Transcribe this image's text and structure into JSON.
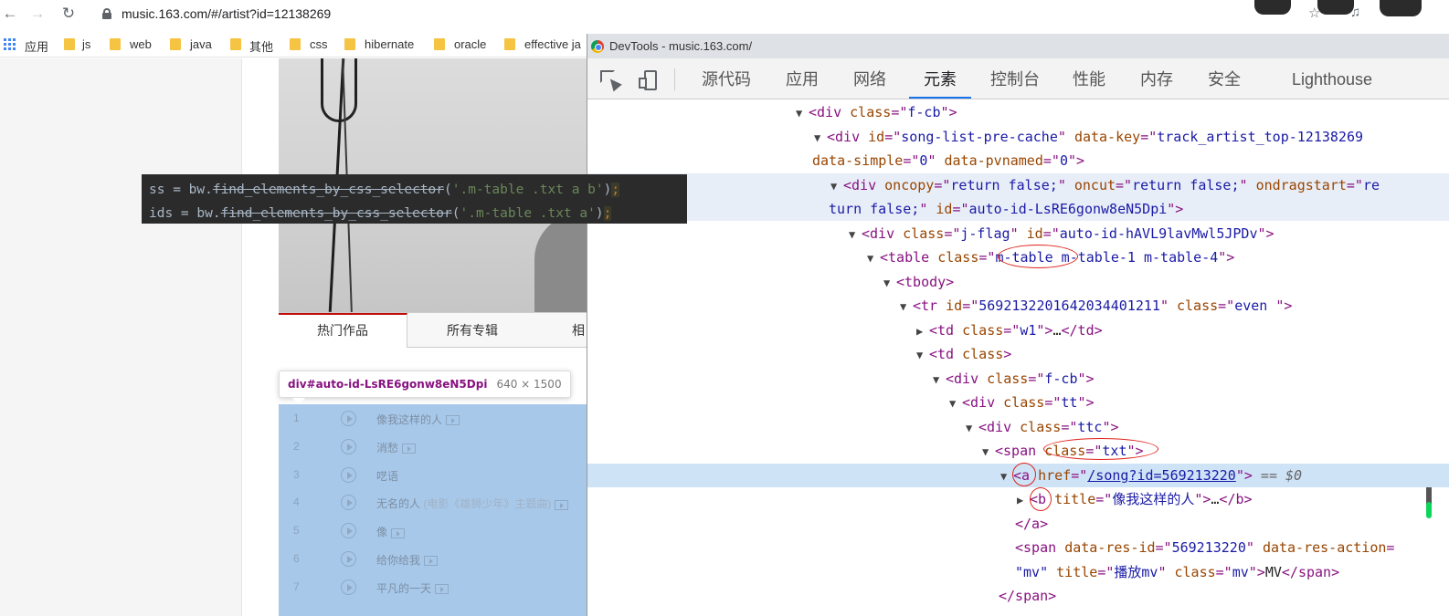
{
  "browser": {
    "url": "music.163.com/#/artist?id=12138269",
    "bookmarks": [
      "应用",
      "js",
      "web",
      "java",
      "其他",
      "css",
      "hibernate",
      "oracle",
      "effective ja"
    ]
  },
  "page": {
    "tabs": [
      "热门作品",
      "所有专辑",
      "相"
    ],
    "tooltip": {
      "selector": "div#auto-id-LsRE6gonw8eN5Dpi",
      "size": "640 × 1500"
    },
    "songs": [
      {
        "num": "1",
        "name": "像我这样的人",
        "sub": "",
        "mv": true
      },
      {
        "num": "2",
        "name": "消愁",
        "sub": "",
        "mv": true
      },
      {
        "num": "3",
        "name": "呓语",
        "sub": "",
        "mv": false
      },
      {
        "num": "4",
        "name": "无名的人",
        "sub": "(电影《雄狮少年》主题曲)",
        "mv": true
      },
      {
        "num": "5",
        "name": "像",
        "sub": "",
        "mv": true
      },
      {
        "num": "6",
        "name": "给你给我",
        "sub": "",
        "mv": true
      },
      {
        "num": "7",
        "name": "平凡的一天",
        "sub": "",
        "mv": true
      }
    ]
  },
  "code": {
    "line1": {
      "pre": "ss = bw.",
      "fn": "find_elements_by_css_selector",
      "open": "(",
      "arg": "'.m-table .txt a b'",
      "close": ")",
      "end": ";"
    },
    "line2": {
      "pre": "ids = bw.",
      "fn": "find_elements_by_css_selector",
      "open": "(",
      "arg": "'.m-table .txt a'",
      "close": ")",
      "end": ";"
    }
  },
  "devtools": {
    "title": "DevTools - music.163.com/",
    "tabs": [
      "源代码",
      "应用",
      "网络",
      "元素",
      "控制台",
      "性能",
      "内存",
      "安全",
      "Lighthouse"
    ],
    "active_tab": "元素",
    "ellipsis": "•••",
    "dom": [
      {
        "tri": "▼",
        "parts": [
          [
            "tag",
            "<div "
          ],
          [
            "attr",
            "class"
          ],
          [
            "tag",
            "=\""
          ],
          [
            "val",
            "f-cb"
          ],
          [
            "tag",
            "\">"
          ]
        ]
      },
      {
        "tri": "▼",
        "parts": [
          [
            "tag",
            "<div "
          ],
          [
            "attr",
            "id"
          ],
          [
            "tag",
            "=\""
          ],
          [
            "val",
            "song-list-pre-cache"
          ],
          [
            "tag",
            "\" "
          ],
          [
            "attr",
            "data-key"
          ],
          [
            "tag",
            "=\""
          ],
          [
            "val",
            "track_artist_top-12138269"
          ]
        ]
      },
      {
        "tri": "",
        "parts": [
          [
            "attr",
            "data-simple"
          ],
          [
            "tag",
            "=\""
          ],
          [
            "val",
            "0"
          ],
          [
            "tag",
            "\" "
          ],
          [
            "attr",
            "data-pvnamed"
          ],
          [
            "tag",
            "=\""
          ],
          [
            "val",
            "0"
          ],
          [
            "tag",
            "\">"
          ]
        ]
      },
      {
        "tri": "▼",
        "parts": [
          [
            "tag",
            "<div "
          ],
          [
            "attr",
            "oncopy"
          ],
          [
            "tag",
            "=\""
          ],
          [
            "val",
            "return false;"
          ],
          [
            "tag",
            "\" "
          ],
          [
            "attr",
            "oncut"
          ],
          [
            "tag",
            "=\""
          ],
          [
            "val",
            "return false;"
          ],
          [
            "tag",
            "\" "
          ],
          [
            "attr",
            "ondragstart"
          ],
          [
            "tag",
            "=\""
          ],
          [
            "val",
            "re"
          ]
        ]
      },
      {
        "tri": "",
        "parts": [
          [
            "val",
            "turn false;"
          ],
          [
            "tag",
            "\" "
          ],
          [
            "attr",
            "id"
          ],
          [
            "tag",
            "=\""
          ],
          [
            "val",
            "auto-id-LsRE6gonw8eN5Dpi"
          ],
          [
            "tag",
            "\">"
          ]
        ]
      },
      {
        "tri": "▼",
        "parts": [
          [
            "tag",
            "<div "
          ],
          [
            "attr",
            "class"
          ],
          [
            "tag",
            "=\""
          ],
          [
            "val",
            "j-flag"
          ],
          [
            "tag",
            "\" "
          ],
          [
            "attr",
            "id"
          ],
          [
            "tag",
            "=\""
          ],
          [
            "val",
            "auto-id-hAVL9lavMwl5JPDv"
          ],
          [
            "tag",
            "\">"
          ]
        ]
      },
      {
        "tri": "▼",
        "parts": [
          [
            "tag",
            "<table "
          ],
          [
            "attr",
            "class"
          ],
          [
            "tag",
            "=\""
          ],
          [
            "val",
            "m-table m-table-1 m-table-4"
          ],
          [
            "tag",
            "\">"
          ]
        ]
      },
      {
        "tri": "▼",
        "parts": [
          [
            "tag",
            "<tbody>"
          ]
        ]
      },
      {
        "tri": "▼",
        "parts": [
          [
            "tag",
            "<tr "
          ],
          [
            "attr",
            "id"
          ],
          [
            "tag",
            "=\""
          ],
          [
            "val",
            "5692132201642034401211"
          ],
          [
            "tag",
            "\" "
          ],
          [
            "attr",
            "class"
          ],
          [
            "tag",
            "=\""
          ],
          [
            "val",
            "even "
          ],
          [
            "tag",
            "\">"
          ]
        ]
      },
      {
        "tri": "▶",
        "parts": [
          [
            "tag",
            "<td "
          ],
          [
            "attr",
            "class"
          ],
          [
            "tag",
            "=\""
          ],
          [
            "val",
            "w1"
          ],
          [
            "tag",
            "\">"
          ],
          [
            "txt",
            "…"
          ],
          [
            "tag",
            "</td>"
          ]
        ]
      },
      {
        "tri": "▼",
        "parts": [
          [
            "tag",
            "<td "
          ],
          [
            "attr",
            "class"
          ],
          [
            "tag",
            ">"
          ]
        ]
      },
      {
        "tri": "▼",
        "parts": [
          [
            "tag",
            "<div "
          ],
          [
            "attr",
            "class"
          ],
          [
            "tag",
            "=\""
          ],
          [
            "val",
            "f-cb"
          ],
          [
            "tag",
            "\">"
          ]
        ]
      },
      {
        "tri": "▼",
        "parts": [
          [
            "tag",
            "<div "
          ],
          [
            "attr",
            "class"
          ],
          [
            "tag",
            "=\""
          ],
          [
            "val",
            "tt"
          ],
          [
            "tag",
            "\">"
          ]
        ]
      },
      {
        "tri": "▼",
        "parts": [
          [
            "tag",
            "<div "
          ],
          [
            "attr",
            "class"
          ],
          [
            "tag",
            "=\""
          ],
          [
            "val",
            "ttc"
          ],
          [
            "tag",
            "\">"
          ]
        ]
      },
      {
        "tri": "▼",
        "parts": [
          [
            "tag",
            "<span "
          ],
          [
            "attr",
            "class"
          ],
          [
            "tag",
            "=\""
          ],
          [
            "val",
            "txt"
          ],
          [
            "tag",
            "\">"
          ]
        ]
      },
      {
        "tri": "▼",
        "parts": [
          [
            "tag",
            "<a "
          ],
          [
            "attr",
            "href"
          ],
          [
            "tag",
            "=\""
          ],
          [
            "link",
            "/song?id=569213220"
          ],
          [
            "tag",
            "\">"
          ],
          [
            "dollar",
            " == $0"
          ]
        ]
      },
      {
        "tri": "▶",
        "parts": [
          [
            "tag",
            "<b "
          ],
          [
            "attr",
            "title"
          ],
          [
            "tag",
            "=\""
          ],
          [
            "val",
            "像我这样的人"
          ],
          [
            "tag",
            "\">"
          ],
          [
            "txt",
            "…"
          ],
          [
            "tag",
            "</b>"
          ]
        ]
      },
      {
        "tri": "",
        "parts": [
          [
            "tag",
            "</a>"
          ]
        ]
      },
      {
        "tri": "",
        "parts": [
          [
            "tag",
            "<span "
          ],
          [
            "attr",
            "data-res-id"
          ],
          [
            "tag",
            "=\""
          ],
          [
            "val",
            "569213220"
          ],
          [
            "tag",
            "\" "
          ],
          [
            "attr",
            "data-res-action"
          ],
          [
            "tag",
            "="
          ]
        ]
      },
      {
        "tri": "",
        "parts": [
          [
            "val",
            "\"mv\""
          ],
          [
            "tag",
            " "
          ],
          [
            "attr",
            "title"
          ],
          [
            "tag",
            "=\""
          ],
          [
            "val",
            "播放mv"
          ],
          [
            "tag",
            "\" "
          ],
          [
            "attr",
            "class"
          ],
          [
            "tag",
            "=\""
          ],
          [
            "val",
            "mv"
          ],
          [
            "tag",
            "\">"
          ],
          [
            "txt",
            "MV"
          ],
          [
            "tag",
            "</span>"
          ]
        ]
      },
      {
        "tri": "",
        "parts": [
          [
            "tag",
            "</span>"
          ]
        ]
      }
    ]
  }
}
